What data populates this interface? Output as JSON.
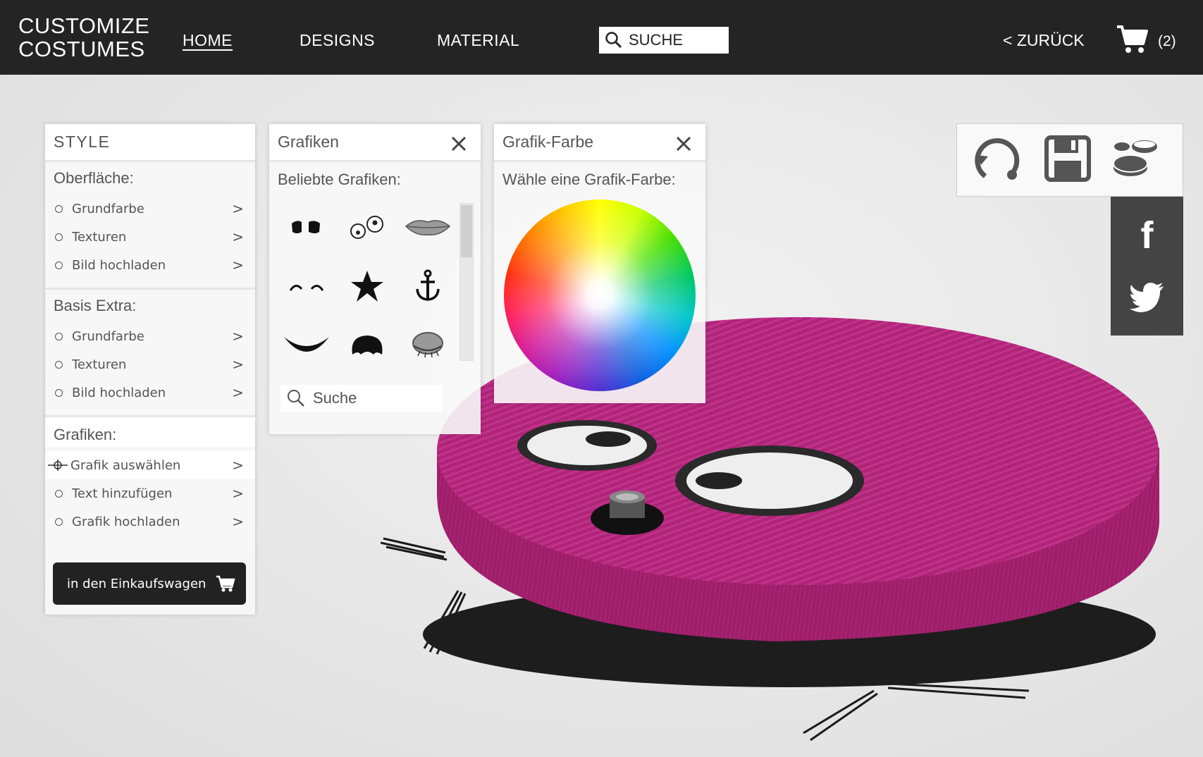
{
  "brand": {
    "line1": "CUSTOMIZE",
    "line2": "COSTUMES"
  },
  "nav": {
    "home": "HOME",
    "designs": "DESIGNS",
    "material": "MATERIAL",
    "search_label": "SUCHE",
    "back": "< ZURÜCK",
    "cart_count": "(2)"
  },
  "style_panel": {
    "title": "STYLE",
    "sections": [
      {
        "title": "Oberfläche:",
        "items": [
          "Grundfarbe",
          "Texturen",
          "Bild hochladen"
        ]
      },
      {
        "title": "Basis Extra:",
        "items": [
          "Grundfarbe",
          "Texturen",
          "Bild hochladen"
        ]
      },
      {
        "title": "Grafiken:",
        "items": [
          "Grafik auswählen",
          "Text hinzufügen",
          "Grafik hochladen"
        ]
      }
    ],
    "chevron": ">",
    "cart_button": "in den Einkaufswagen"
  },
  "graphics_panel": {
    "title": "Grafiken",
    "subtitle": "Beliebte Grafiken:",
    "icons": [
      "dark-eyes-icon",
      "googly-eyes-icon",
      "lips-icon",
      "closed-eyes-icon",
      "star-icon",
      "anchor-icon",
      "smile-icon",
      "nose-icon",
      "closed-eye-lashes-icon"
    ],
    "search_label": "Suche"
  },
  "color_panel": {
    "title": "Grafik-Farbe",
    "subtitle": "Wähle eine Grafik-Farbe:"
  },
  "actions": [
    "reset-icon",
    "save-icon",
    "layers-icon"
  ],
  "social": [
    "facebook-icon",
    "twitter-icon"
  ],
  "colors": {
    "nav_bg": "#242424",
    "robot_fur": "#b8287f",
    "button_bg": "#222222"
  }
}
